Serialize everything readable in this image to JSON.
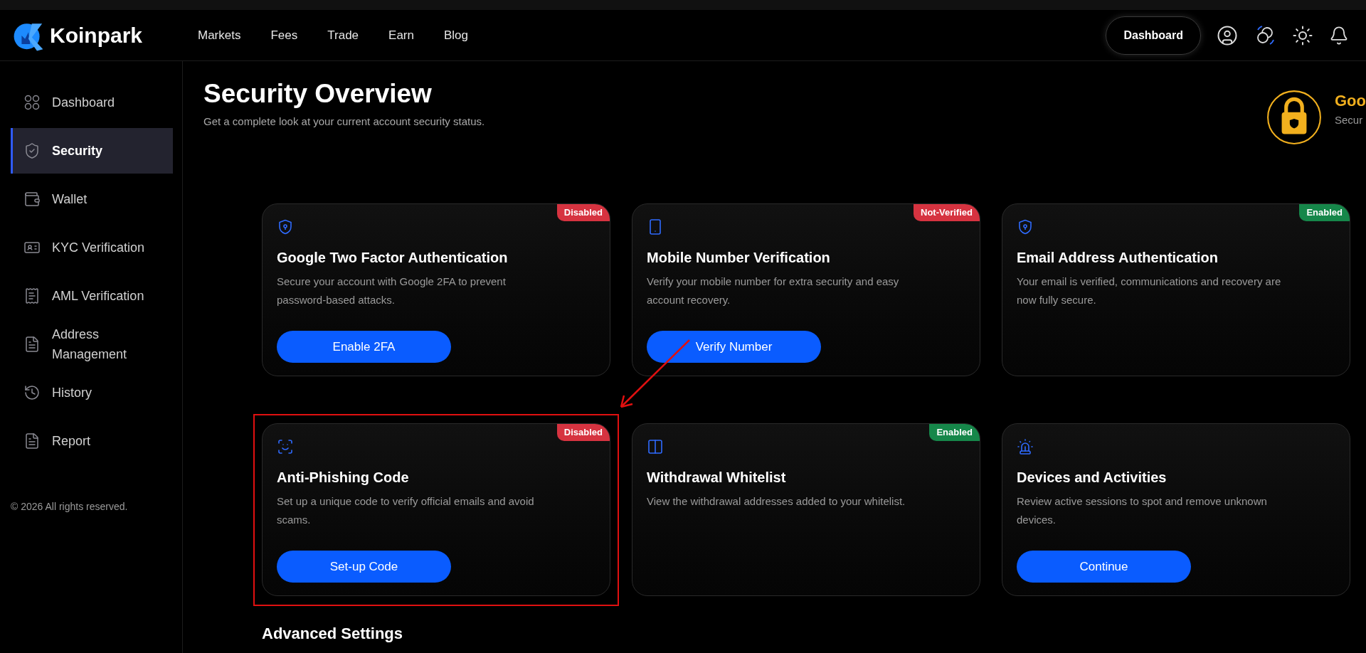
{
  "brand": {
    "name": "Koinpark"
  },
  "nav": [
    "Markets",
    "Fees",
    "Trade",
    "Earn",
    "Blog"
  ],
  "header_button": "Dashboard",
  "sidebar": {
    "items": [
      {
        "label": "Dashboard",
        "selected": false
      },
      {
        "label": "Security",
        "selected": true
      },
      {
        "label": "Wallet",
        "selected": false
      },
      {
        "label": "KYC Verification",
        "selected": false
      },
      {
        "label": "AML Verification",
        "selected": false
      },
      {
        "label": "Address Management",
        "selected": false
      },
      {
        "label": "History",
        "selected": false
      },
      {
        "label": "Report",
        "selected": false
      }
    ],
    "footer": "© 2026 All rights reserved."
  },
  "page": {
    "title": "Security Overview",
    "subtitle": "Get a complete look at your current account security status."
  },
  "security_level": {
    "label": "Goo",
    "caption": "Secur"
  },
  "cards": [
    {
      "title": "Google Two Factor Authentication",
      "description": "Secure your account with Google 2FA to prevent password-based attacks.",
      "badge": {
        "text": "Disabled",
        "color": "#d63340"
      },
      "button": "Enable 2FA",
      "highlighted": false
    },
    {
      "title": "Mobile Number Verification",
      "description": "Verify your mobile number for extra security and easy account recovery.",
      "badge": {
        "text": "Not-Verified",
        "color": "#d63340"
      },
      "button": "Verify Number",
      "highlighted": false
    },
    {
      "title": "Email Address Authentication",
      "description": "Your email is verified, communications and recovery are now fully secure.",
      "badge": {
        "text": "Enabled",
        "color": "#16874a"
      },
      "highlighted": false
    },
    {
      "title": "Anti-Phishing Code",
      "description": "Set up a unique code to verify official emails and avoid scams.",
      "badge": {
        "text": "Disabled",
        "color": "#d63340"
      },
      "button": "Set-up Code",
      "highlighted": true
    },
    {
      "title": "Withdrawal Whitelist",
      "description": "View the withdrawal addresses added to your whitelist.",
      "badge": {
        "text": "Enabled",
        "color": "#16874a"
      },
      "highlighted": false
    },
    {
      "title": "Devices and Activities",
      "description": "Review active sessions to spot and remove unknown devices.",
      "button": "Continue",
      "highlighted": false
    }
  ],
  "section_heading": "Advanced Settings"
}
